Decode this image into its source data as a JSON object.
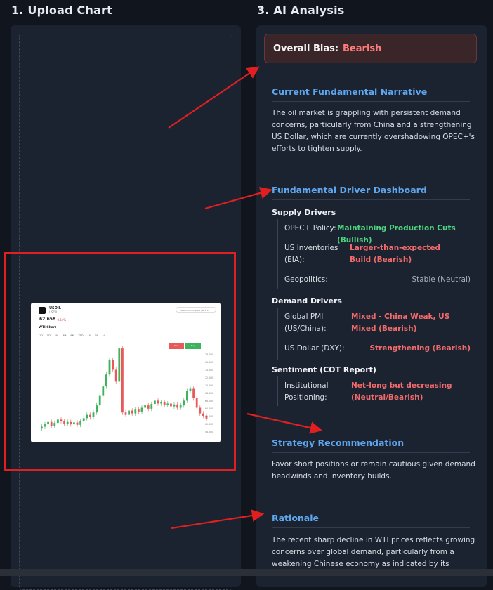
{
  "upload": {
    "title": "1. Upload Chart"
  },
  "analysis": {
    "title": "3. AI Analysis",
    "bias_label": "Overall Bias:",
    "bias_value": "Bearish",
    "narrative": {
      "heading": "Current Fundamental Narrative",
      "text": "The oil market is grappling with persistent demand concerns, particularly from China and a strengthening US Dollar, which are currently overshadowing OPEC+'s efforts to tighten supply."
    },
    "dashboard": {
      "heading": "Fundamental Driver Dashboard",
      "supply_heading": "Supply Drivers",
      "opec_key": "OPEC+ Policy:",
      "opec_val": "Maintaining Production Cuts (Bullish)",
      "inv_key": "US Inventories (EIA):",
      "inv_val": "Larger-than-expected Build (Bearish)",
      "geo_key": "Geopolitics:",
      "geo_val": "Stable (Neutral)",
      "demand_heading": "Demand Drivers",
      "pmi_key": "Global PMI (US/China):",
      "pmi_val": "Mixed - China Weak, US Mixed (Bearish)",
      "usd_key": "US Dollar (DXY):",
      "usd_val": "Strengthening (Bearish)",
      "sentiment_heading": "Sentiment (COT Report)",
      "inst_key": "Institutional Positioning:",
      "inst_val": "Net-long but decreasing (Neutral/Bearish)"
    },
    "strategy": {
      "heading": "Strategy Recommendation",
      "text": "Favor short positions or remain cautious given demand headwinds and inventory builds."
    },
    "rationale": {
      "heading": "Rationale",
      "text": "The recent sharp decline in WTI prices reflects growing concerns over global demand, particularly from a weakening Chinese economy as indicated by its"
    }
  },
  "thumbnail": {
    "symbol": "USOIL",
    "subsymbol": "USOIL",
    "price": "62.658",
    "change": "-0.64%",
    "search_placeholder": "Search & Compare (⌘ + K)",
    "chart_title": "WTI Chart",
    "timeframes": [
      "1D",
      "5D",
      "1M",
      "3M",
      "6M",
      "YTD",
      "1Y",
      "5Y",
      "All"
    ],
    "sell_label": "Sell",
    "buy_label": "Buy",
    "price_labels": [
      "78.000",
      "76.000",
      "74.000",
      "72.000",
      "70.000",
      "68.000",
      "66.000",
      "64.000",
      "62.000",
      "60.000",
      "58.000"
    ]
  },
  "colors": {
    "accent": "#5ea6ee",
    "bearish": "#f26b6b",
    "bullish": "#4cd47e",
    "annotation": "#e02020"
  }
}
